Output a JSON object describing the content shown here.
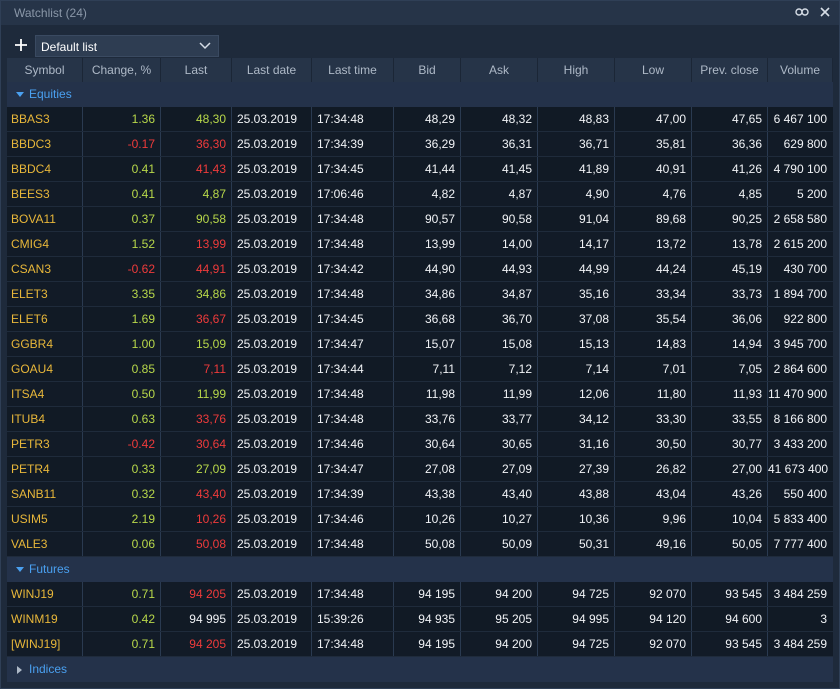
{
  "window": {
    "title": "Watchlist  (24)"
  },
  "toolbar": {
    "list_name": "Default list"
  },
  "columns": [
    "Symbol",
    "Change, %",
    "Last",
    "Last date",
    "Last time",
    "Bid",
    "Ask",
    "High",
    "Low",
    "Prev. close",
    "Volume"
  ],
  "groups": [
    {
      "label": "Equities",
      "expanded": true,
      "rows": [
        {
          "symbol": "BBAS3",
          "change": "1.36",
          "dir": "up",
          "last": "48,30",
          "date": "25.03.2019",
          "time": "17:34:48",
          "bid": "48,29",
          "ask": "48,32",
          "high": "48,83",
          "low": "47,00",
          "prev": "47,65",
          "volume": "6 467 100"
        },
        {
          "symbol": "BBDC3",
          "change": "-0.17",
          "dir": "down",
          "last": "36,30",
          "date": "25.03.2019",
          "time": "17:34:39",
          "bid": "36,29",
          "ask": "36,31",
          "high": "36,71",
          "low": "35,81",
          "prev": "36,36",
          "volume": "629 800"
        },
        {
          "symbol": "BBDC4",
          "change": "0.41",
          "dir": "up",
          "last": "41,43",
          "lastdir": "down",
          "date": "25.03.2019",
          "time": "17:34:45",
          "bid": "41,44",
          "ask": "41,45",
          "high": "41,89",
          "low": "40,91",
          "prev": "41,26",
          "volume": "4 790 100"
        },
        {
          "symbol": "BEES3",
          "change": "0.41",
          "dir": "up",
          "last": "4,87",
          "date": "25.03.2019",
          "time": "17:06:46",
          "bid": "4,82",
          "ask": "4,87",
          "high": "4,90",
          "low": "4,76",
          "prev": "4,85",
          "volume": "5 200"
        },
        {
          "symbol": "BOVA11",
          "change": "0.37",
          "dir": "up",
          "last": "90,58",
          "date": "25.03.2019",
          "time": "17:34:48",
          "bid": "90,57",
          "ask": "90,58",
          "high": "91,04",
          "low": "89,68",
          "prev": "90,25",
          "volume": "2 658 580"
        },
        {
          "symbol": "CMIG4",
          "change": "1.52",
          "dir": "up",
          "last": "13,99",
          "lastdir": "down",
          "date": "25.03.2019",
          "time": "17:34:48",
          "bid": "13,99",
          "ask": "14,00",
          "high": "14,17",
          "low": "13,72",
          "prev": "13,78",
          "volume": "2 615 200"
        },
        {
          "symbol": "CSAN3",
          "change": "-0.62",
          "dir": "down",
          "last": "44,91",
          "date": "25.03.2019",
          "time": "17:34:42",
          "bid": "44,90",
          "ask": "44,93",
          "high": "44,99",
          "low": "44,24",
          "prev": "45,19",
          "volume": "430 700"
        },
        {
          "symbol": "ELET3",
          "change": "3.35",
          "dir": "up",
          "last": "34,86",
          "date": "25.03.2019",
          "time": "17:34:48",
          "bid": "34,86",
          "ask": "34,87",
          "high": "35,16",
          "low": "33,34",
          "prev": "33,73",
          "volume": "1 894 700"
        },
        {
          "symbol": "ELET6",
          "change": "1.69",
          "dir": "up",
          "last": "36,67",
          "lastdir": "down",
          "date": "25.03.2019",
          "time": "17:34:45",
          "bid": "36,68",
          "ask": "36,70",
          "high": "37,08",
          "low": "35,54",
          "prev": "36,06",
          "volume": "922 800"
        },
        {
          "symbol": "GGBR4",
          "change": "1.00",
          "dir": "up",
          "last": "15,09",
          "date": "25.03.2019",
          "time": "17:34:47",
          "bid": "15,07",
          "ask": "15,08",
          "high": "15,13",
          "low": "14,83",
          "prev": "14,94",
          "volume": "3 945 700"
        },
        {
          "symbol": "GOAU4",
          "change": "0.85",
          "dir": "up",
          "last": "7,11",
          "lastdir": "down",
          "date": "25.03.2019",
          "time": "17:34:44",
          "bid": "7,11",
          "ask": "7,12",
          "high": "7,14",
          "low": "7,01",
          "prev": "7,05",
          "volume": "2 864 600"
        },
        {
          "symbol": "ITSA4",
          "change": "0.50",
          "dir": "up",
          "last": "11,99",
          "date": "25.03.2019",
          "time": "17:34:48",
          "bid": "11,98",
          "ask": "11,99",
          "high": "12,06",
          "low": "11,80",
          "prev": "11,93",
          "volume": "11 470 900"
        },
        {
          "symbol": "ITUB4",
          "change": "0.63",
          "dir": "up",
          "last": "33,76",
          "lastdir": "down",
          "date": "25.03.2019",
          "time": "17:34:48",
          "bid": "33,76",
          "ask": "33,77",
          "high": "34,12",
          "low": "33,30",
          "prev": "33,55",
          "volume": "8 166 800"
        },
        {
          "symbol": "PETR3",
          "change": "-0.42",
          "dir": "down",
          "last": "30,64",
          "date": "25.03.2019",
          "time": "17:34:46",
          "bid": "30,64",
          "ask": "30,65",
          "high": "31,16",
          "low": "30,50",
          "prev": "30,77",
          "volume": "3 433 200"
        },
        {
          "symbol": "PETR4",
          "change": "0.33",
          "dir": "up",
          "last": "27,09",
          "date": "25.03.2019",
          "time": "17:34:47",
          "bid": "27,08",
          "ask": "27,09",
          "high": "27,39",
          "low": "26,82",
          "prev": "27,00",
          "volume": "41 673 400"
        },
        {
          "symbol": "SANB11",
          "change": "0.32",
          "dir": "up",
          "last": "43,40",
          "lastdir": "down",
          "date": "25.03.2019",
          "time": "17:34:39",
          "bid": "43,38",
          "ask": "43,40",
          "high": "43,88",
          "low": "43,04",
          "prev": "43,26",
          "volume": "550 400"
        },
        {
          "symbol": "USIM5",
          "change": "2.19",
          "dir": "up",
          "last": "10,26",
          "lastdir": "down",
          "date": "25.03.2019",
          "time": "17:34:46",
          "bid": "10,26",
          "ask": "10,27",
          "high": "10,36",
          "low": "9,96",
          "prev": "10,04",
          "volume": "5 833 400"
        },
        {
          "symbol": "VALE3",
          "change": "0.06",
          "dir": "up",
          "last": "50,08",
          "lastdir": "down",
          "date": "25.03.2019",
          "time": "17:34:48",
          "bid": "50,08",
          "ask": "50,09",
          "high": "50,31",
          "low": "49,16",
          "prev": "50,05",
          "volume": "7 777 400"
        }
      ]
    },
    {
      "label": "Futures",
      "expanded": true,
      "rows": [
        {
          "symbol": "WINJ19",
          "change": "0.71",
          "dir": "up",
          "last": "94 205",
          "lastdir": "down",
          "date": "25.03.2019",
          "time": "17:34:48",
          "bid": "94 195",
          "ask": "94 200",
          "high": "94 725",
          "low": "92 070",
          "prev": "93 545",
          "volume": "3 484 259"
        },
        {
          "symbol": "WINM19",
          "change": "0.42",
          "dir": "up",
          "last": "94 995",
          "lastdir": "neutral",
          "date": "25.03.2019",
          "time": "15:39:26",
          "bid": "94 935",
          "ask": "95 205",
          "high": "94 995",
          "low": "94 120",
          "prev": "94 600",
          "volume": "3"
        },
        {
          "symbol": "[WINJ19]",
          "change": "0.71",
          "dir": "up",
          "last": "94 205",
          "lastdir": "down",
          "date": "25.03.2019",
          "time": "17:34:48",
          "bid": "94 195",
          "ask": "94 200",
          "high": "94 725",
          "low": "92 070",
          "prev": "93 545",
          "volume": "3 484 259"
        }
      ]
    },
    {
      "label": "Indices",
      "expanded": false,
      "rows": []
    }
  ],
  "colors": {
    "positive": "#b8d84a",
    "negative": "#ef3b3b",
    "symbol": "#e8b73a",
    "group": "#4aa0f0"
  },
  "icons": {
    "link": "link-icon",
    "close": "close-icon",
    "add": "plus-icon",
    "dropdown": "chevron-down-icon"
  }
}
